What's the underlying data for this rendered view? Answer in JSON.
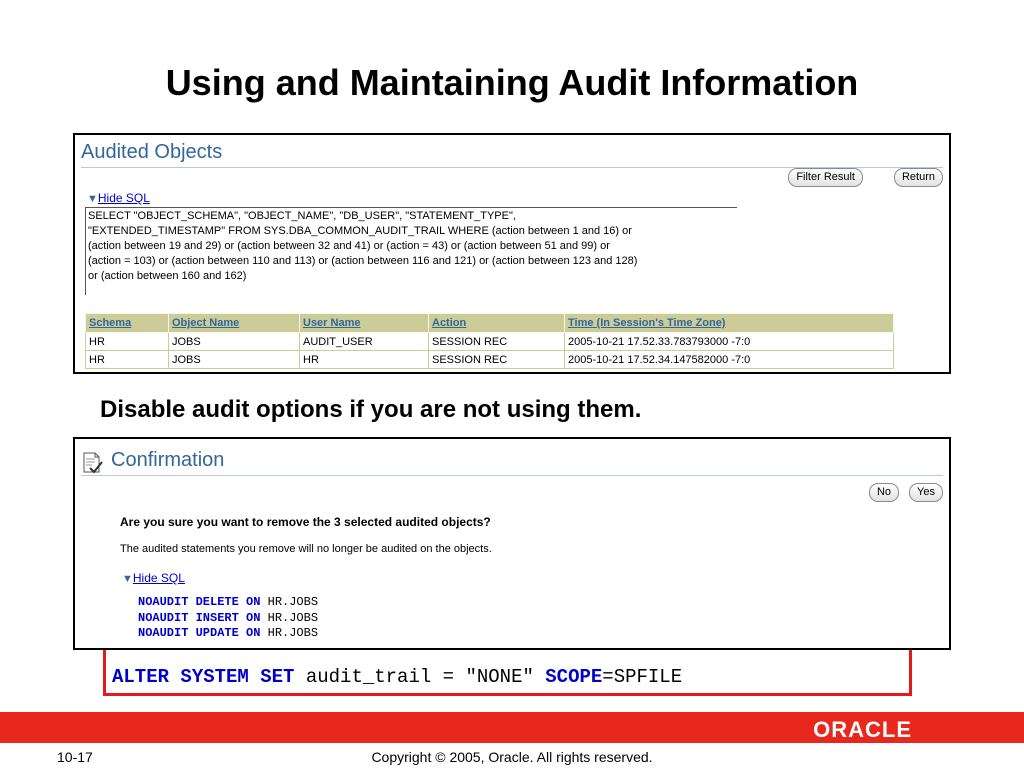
{
  "slide": {
    "title": "Using and Maintaining Audit Information",
    "subtitle": "Disable audit options if you are not using them.",
    "alter_statement": {
      "kw1": "ALTER SYSTEM SET",
      "middle": " audit_trail = \"NONE\" ",
      "kw2": "SCOPE",
      "tail": "=SPFILE"
    },
    "page_number": "10-17",
    "copyright": "Copyright © 2005, Oracle.  All rights reserved.",
    "logo": "ORACLE"
  },
  "audited_objects": {
    "heading": "Audited Objects",
    "buttons": {
      "filter": "Filter Result",
      "return": "Return"
    },
    "hide_sql": "Hide SQL",
    "sql_lines": [
      "SELECT \"OBJECT_SCHEMA\", \"OBJECT_NAME\", \"DB_USER\", \"STATEMENT_TYPE\",",
      "\"EXTENDED_TIMESTAMP\" FROM SYS.DBA_COMMON_AUDIT_TRAIL WHERE (action between 1 and 16) or",
      "(action between 19 and 29) or (action between 32 and 41) or (action = 43) or (action between 51 and 99) or",
      "(action = 103) or (action between 110 and 113) or (action between 116 and 121) or (action between 123 and 128)",
      "or (action between 160 and 162)"
    ],
    "table": {
      "columns": [
        "Schema",
        "Object Name",
        "User Name",
        "Action",
        "Time (In Session's Time Zone)"
      ],
      "rows": [
        [
          "HR",
          "JOBS",
          "AUDIT_USER",
          "SESSION REC",
          "2005-10-21 17.52.33.783793000 -7:0"
        ],
        [
          "HR",
          "JOBS",
          "HR",
          "SESSION REC",
          "2005-10-21 17.52.34.147582000 -7:0"
        ]
      ]
    }
  },
  "confirmation": {
    "heading": "Confirmation",
    "buttons": {
      "no": "No",
      "yes": "Yes"
    },
    "question": "Are you sure you want to remove the 3 selected audited objects?",
    "note": "The audited statements you remove will no longer be audited on the objects.",
    "hide_sql": "Hide SQL",
    "code_lines": [
      {
        "kw": "NOAUDIT DELETE ON",
        "obj": " HR.JOBS"
      },
      {
        "kw": "NOAUDIT INSERT ON",
        "obj": " HR.JOBS"
      },
      {
        "kw": "NOAUDIT UPDATE ON",
        "obj": " HR.JOBS"
      }
    ]
  },
  "colors": {
    "accent_red": "#e8281d",
    "heading_blue": "#336699",
    "link_blue": "#0000cc",
    "table_header": "#cccc99"
  }
}
